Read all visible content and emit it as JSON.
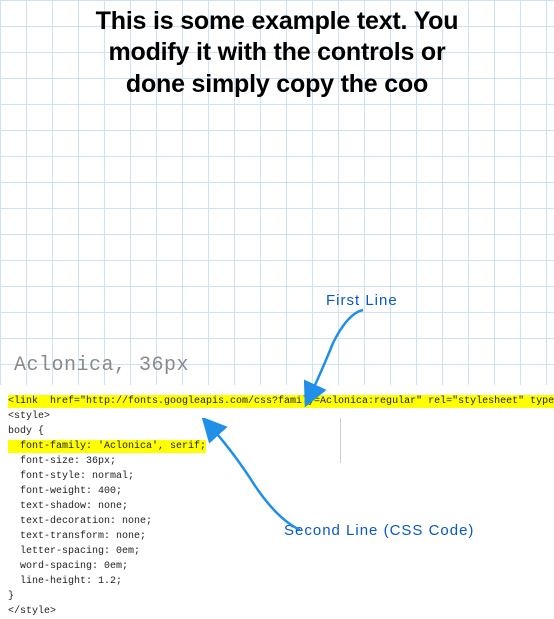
{
  "example": {
    "line1": "This is some example text. You",
    "line2": "modify it with the controls or",
    "line3": "done simply copy the coo"
  },
  "font_label": "Aclonica, 36px",
  "code": {
    "link_line": "<link  href=\"http://fonts.googleapis.com/css?family=Aclonica:regular\" rel=\"stylesheet\" type=\"te",
    "open_style": "<style>",
    "body_open": "body {",
    "font_family": "  font-family: 'Aclonica', serif;",
    "font_size": "  font-size: 36px;",
    "font_style": "  font-style: normal;",
    "font_weight": "  font-weight: 400;",
    "text_shadow": "  text-shadow: none;",
    "text_decoration": "  text-decoration: none;",
    "text_transform": "  text-transform: none;",
    "letter_spacing": "  letter-spacing: 0em;",
    "word_spacing": "  word-spacing: 0em;",
    "line_height": "  line-height: 1.2;",
    "body_close": "}",
    "close_style": "</style>"
  },
  "annotations": {
    "first": "First Line",
    "second": "Second Line  (CSS Code)"
  }
}
